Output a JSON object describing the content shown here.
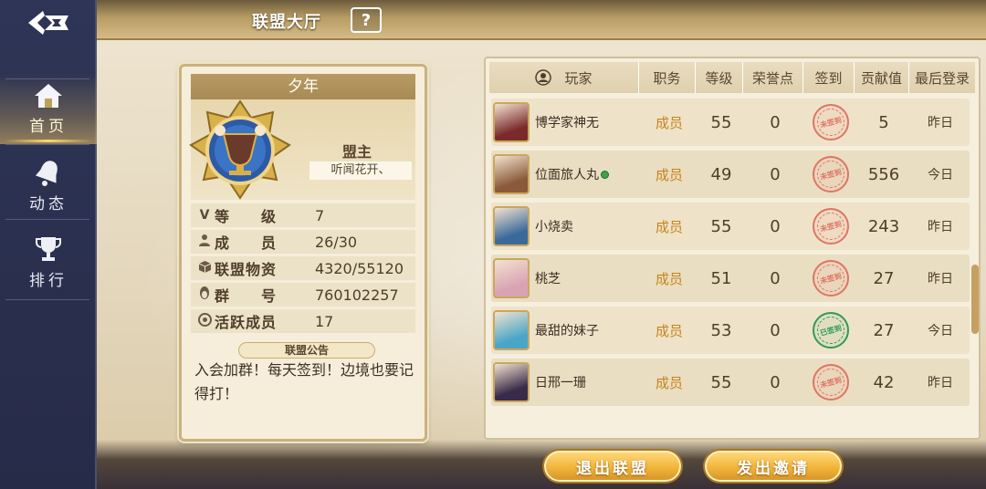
{
  "header": {
    "title": "联盟大厅",
    "help_label": "?"
  },
  "nav": {
    "items": [
      {
        "label": "首页",
        "icon": "home-icon",
        "active": true
      },
      {
        "label": "动态",
        "icon": "bell-icon",
        "active": false
      },
      {
        "label": "排行",
        "icon": "trophy-icon",
        "active": false
      }
    ]
  },
  "alliance": {
    "name": "夕年",
    "leader_title": "盟主",
    "leader_name": "听闻花开、",
    "stats": [
      {
        "icon": "v-icon",
        "label": "等　　级",
        "value": "7"
      },
      {
        "icon": "person-icon",
        "label": "成　　员",
        "value": "26/30"
      },
      {
        "icon": "box-icon",
        "label": "联盟物资",
        "value": "4320/55120"
      },
      {
        "icon": "penguin-icon",
        "label": "群　　号",
        "value": "760102257"
      },
      {
        "icon": "active-icon",
        "label": "活跃成员",
        "value": "17"
      }
    ],
    "notice_label": "联盟公告",
    "notice_text": "入会加群！每天签到！边境也要记得打！"
  },
  "table": {
    "columns": [
      "玩家",
      "职务",
      "等级",
      "荣誉点",
      "签到",
      "贡献值",
      "最后登录"
    ],
    "rows": [
      {
        "player": "博学家神无",
        "role": "成员",
        "level": "55",
        "honor": "0",
        "signed": false,
        "contribution": "5",
        "last_login": "昨日",
        "online": false,
        "avatar_color": "#7a2a2a"
      },
      {
        "player": "位面旅人丸",
        "role": "成员",
        "level": "49",
        "honor": "0",
        "signed": false,
        "contribution": "556",
        "last_login": "今日",
        "online": true,
        "avatar_color": "#8a5a3a"
      },
      {
        "player": "小烧卖",
        "role": "成员",
        "level": "55",
        "honor": "0",
        "signed": false,
        "contribution": "243",
        "last_login": "昨日",
        "online": false,
        "avatar_color": "#3a6a9a"
      },
      {
        "player": "桃芝",
        "role": "成员",
        "level": "51",
        "honor": "0",
        "signed": false,
        "contribution": "27",
        "last_login": "昨日",
        "online": false,
        "avatar_color": "#d9a3b4"
      },
      {
        "player": "最甜的妹子",
        "role": "成员",
        "level": "53",
        "honor": "0",
        "signed": true,
        "contribution": "27",
        "last_login": "今日",
        "online": false,
        "avatar_color": "#4aa6c8"
      },
      {
        "player": "日邢一珊",
        "role": "成员",
        "level": "55",
        "honor": "0",
        "signed": false,
        "contribution": "42",
        "last_login": "昨日",
        "online": false,
        "avatar_color": "#3a2a4a"
      }
    ],
    "stamp_text_red": "未签到",
    "stamp_text_green": "已签到"
  },
  "actions": {
    "leave_label": "退出联盟",
    "invite_label": "发出邀请"
  }
}
